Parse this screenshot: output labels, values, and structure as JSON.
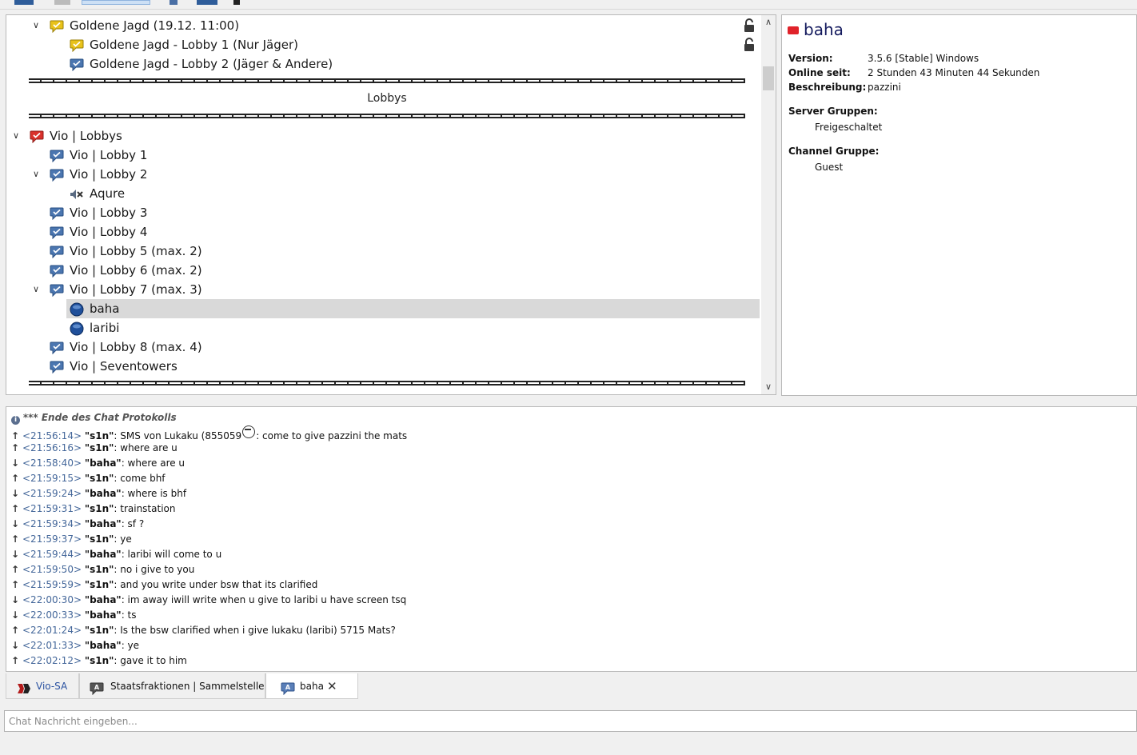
{
  "tree": {
    "rows": [
      {
        "label": "Goldene Jagd (19.12. 11:00)",
        "icon": "channel-yellow-icon",
        "expanded": true,
        "lock": true
      },
      {
        "label": "Goldene Jagd - Lobby 1 (Nur Jäger)",
        "icon": "channel-yellow-icon",
        "lock": true
      },
      {
        "label": "Goldene Jagd -  Lobby 2 (Jäger & Andere)",
        "icon": "channel-blue-icon"
      },
      {
        "label": "Vio | Lobbys",
        "icon": "channel-red-icon",
        "expanded": true
      },
      {
        "label": "Vio | Lobby 1",
        "icon": "channel-blue-icon"
      },
      {
        "label": "Vio | Lobby 2",
        "icon": "channel-blue-icon",
        "expanded": true
      },
      {
        "label": "Aqure",
        "icon": "user-muted-icon"
      },
      {
        "label": "Vio | Lobby 3",
        "icon": "channel-blue-icon"
      },
      {
        "label": "Vio | Lobby 4",
        "icon": "channel-blue-icon"
      },
      {
        "label": "Vio | Lobby 5 (max. 2)",
        "icon": "channel-blue-icon"
      },
      {
        "label": "Vio | Lobby 6 (max. 2)",
        "icon": "channel-blue-icon"
      },
      {
        "label": "Vio | Lobby 7 (max. 3)",
        "icon": "channel-blue-icon",
        "expanded": true
      },
      {
        "label": "baha",
        "icon": "user-blue-icon",
        "selected": true
      },
      {
        "label": "laribi",
        "icon": "user-blue-icon"
      },
      {
        "label": "Vio | Lobby 8 (max. 4)",
        "icon": "channel-blue-icon"
      },
      {
        "label": "Vio | Seventowers",
        "icon": "channel-blue-icon"
      }
    ],
    "spacer_title": "Lobbys"
  },
  "info": {
    "username": "baha",
    "version_label": "Version:",
    "version_value": "3.5.6 [Stable] Windows",
    "online_label": "Online seit:",
    "online_value": "2 Stunden 43 Minuten 44 Sekunden",
    "desc_label": "Beschreibung:",
    "desc_value": "pazzini",
    "server_groups_label": "Server Gruppen:",
    "server_groups_value": "Freigeschaltet",
    "channel_group_label": "Channel Gruppe:",
    "channel_group_value": "Guest"
  },
  "chat": {
    "end_line": "*** Ende des Chat Protokolls",
    "messages": [
      {
        "dir": "out",
        "time": "<21:56:14>",
        "nick": "\"s1n\"",
        "text": ": SMS von Lukaku (855059",
        "emoji": true,
        "text2": ": come to give pazzini the mats"
      },
      {
        "dir": "out",
        "time": "<21:56:16>",
        "nick": "\"s1n\"",
        "text": ": where are u"
      },
      {
        "dir": "in",
        "time": "<21:58:40>",
        "nick": "\"baha\"",
        "text": ": where are u"
      },
      {
        "dir": "out",
        "time": "<21:59:15>",
        "nick": "\"s1n\"",
        "text": ": come bhf"
      },
      {
        "dir": "in",
        "time": "<21:59:24>",
        "nick": "\"baha\"",
        "text": ": where is bhf"
      },
      {
        "dir": "out",
        "time": "<21:59:31>",
        "nick": "\"s1n\"",
        "text": ": trainstation"
      },
      {
        "dir": "in",
        "time": "<21:59:34>",
        "nick": "\"baha\"",
        "text": ": sf ?"
      },
      {
        "dir": "out",
        "time": "<21:59:37>",
        "nick": "\"s1n\"",
        "text": ": ye"
      },
      {
        "dir": "in",
        "time": "<21:59:44>",
        "nick": "\"baha\"",
        "text": ": laribi will come to u"
      },
      {
        "dir": "out",
        "time": "<21:59:50>",
        "nick": "\"s1n\"",
        "text": ": no i give to you"
      },
      {
        "dir": "out",
        "time": "<21:59:59>",
        "nick": "\"s1n\"",
        "text": ": and you write under bsw that its clarified"
      },
      {
        "dir": "in",
        "time": "<22:00:30>",
        "nick": "\"baha\"",
        "text": ": im away iwill write when u give to laribi u have screen tsq"
      },
      {
        "dir": "in",
        "time": "<22:00:33>",
        "nick": "\"baha\"",
        "text": ": ts"
      },
      {
        "dir": "out",
        "time": "<22:01:24>",
        "nick": "\"s1n\"",
        "text": ": Is the bsw clarified when i give lukaku (laribi) 5715 Mats?"
      },
      {
        "dir": "in",
        "time": "<22:01:33>",
        "nick": "\"baha\"",
        "text": ": ye"
      },
      {
        "dir": "out",
        "time": "<22:02:12>",
        "nick": "\"s1n\"",
        "text": ": gave it to him"
      }
    ]
  },
  "tabs": [
    {
      "label": "Vio-SA",
      "icon": "server-icon"
    },
    {
      "label": "Staatsfraktionen | Sammelstelle",
      "icon": "channel-chat-icon"
    },
    {
      "label": "baha",
      "icon": "private-chat-icon",
      "active": true,
      "close": "✕"
    }
  ],
  "input": {
    "placeholder": "Chat Nachricht eingeben...",
    "value": ""
  }
}
